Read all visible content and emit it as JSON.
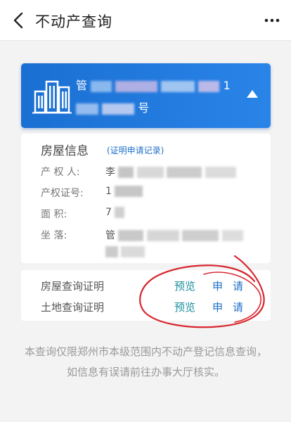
{
  "nav": {
    "title": "不动产查询",
    "back_icon": "chevron-left-icon",
    "more_icon": "more-dots-icon"
  },
  "property": {
    "line1_prefix": "管",
    "line1_suffix": "1",
    "line2_suffix": "号",
    "icon": "building-icon",
    "toggle_icon": "triangle-up-icon",
    "card_color": "#1a6fd2"
  },
  "house_info": {
    "heading": "房屋信息",
    "record_link": "(证明申请记录)",
    "rows": [
      {
        "label": "产 权 人:",
        "value": "李"
      },
      {
        "label": "产权证号:",
        "value": "1"
      },
      {
        "label": "面      积:",
        "value": "7"
      },
      {
        "label": "坐      落:",
        "value": "管"
      }
    ]
  },
  "certificates": [
    {
      "label": "房屋查询证明",
      "preview": "预览",
      "apply": "申请"
    },
    {
      "label": "土地查询证明",
      "preview": "预览",
      "apply": "申请"
    }
  ],
  "notice": "本查询仅限郑州市本级范围内不动产登记信息查询，如信息有误请前往办事大厅核实。",
  "colors": {
    "accent": "#1e6fc8",
    "preview": "#1e90a0",
    "annotation": "#d8262e"
  }
}
